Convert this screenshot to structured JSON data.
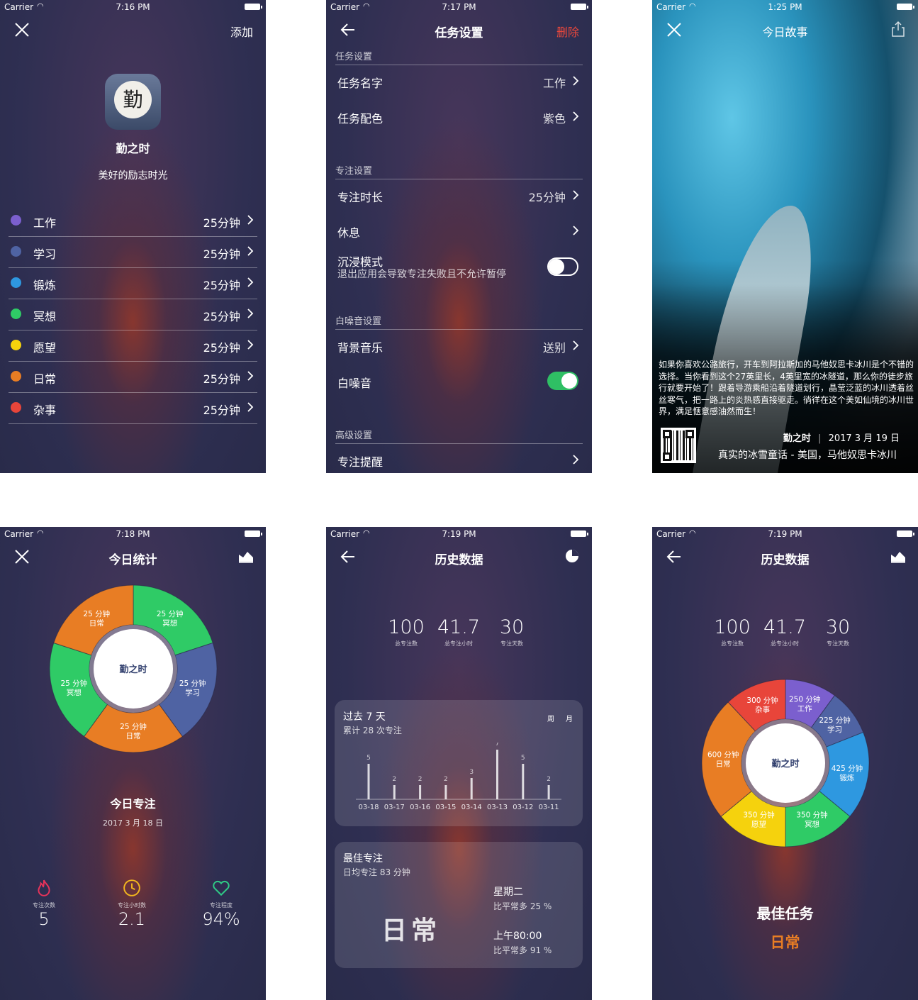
{
  "colors": {
    "accent_red": "#e9483c",
    "toggle_on": "#2fbf64",
    "work": "#7b5fce",
    "study": "#4f63a3",
    "exercise": "#2e98e0",
    "meditate": "#2fcb66",
    "wish": "#f5d20d",
    "daily": "#e87d24",
    "misc": "#e8453a"
  },
  "screen1": {
    "status": {
      "carrier": "Carrier",
      "time": "7:16 PM"
    },
    "nav_right": "添加",
    "app_name": "勤之时",
    "icon_char": "勤",
    "slogan": "美好的励志时光",
    "tasks": [
      {
        "name": "工作",
        "value": "25分钟",
        "color": "#7b5fce"
      },
      {
        "name": "学习",
        "value": "25分钟",
        "color": "#4f63a3"
      },
      {
        "name": "锻炼",
        "value": "25分钟",
        "color": "#2e98e0"
      },
      {
        "name": "冥想",
        "value": "25分钟",
        "color": "#2fcb66"
      },
      {
        "name": "愿望",
        "value": "25分钟",
        "color": "#f5d20d"
      },
      {
        "name": "日常",
        "value": "25分钟",
        "color": "#e87d24"
      },
      {
        "name": "杂事",
        "value": "25分钟",
        "color": "#e8453a"
      }
    ]
  },
  "screen2": {
    "status": {
      "carrier": "Carrier",
      "time": "7:17 PM"
    },
    "title": "任务设置",
    "nav_right": "删除",
    "sections": {
      "task": "任务设置",
      "focus": "专注设置",
      "noise": "白噪音设置",
      "advanced": "高级设置"
    },
    "rows": {
      "task_name": {
        "label": "任务名字",
        "value": "工作"
      },
      "task_color": {
        "label": "任务配色",
        "value": "紫色"
      },
      "focus_len": {
        "label": "专注时长",
        "value": "25分钟"
      },
      "rest": {
        "label": "休息",
        "value": ""
      },
      "immersive": {
        "label": "沉浸模式",
        "sub": "退出应用会导致专注失败且不允许暂停",
        "on": false
      },
      "bgm": {
        "label": "背景音乐",
        "value": "送别"
      },
      "white_noise": {
        "label": "白噪音",
        "on": true
      },
      "reminder": {
        "label": "专注提醒",
        "value": ""
      }
    }
  },
  "screen3": {
    "status": {
      "carrier": "Carrier",
      "time": "1:25 PM"
    },
    "title": "今日故事",
    "story": "如果你喜欢公路旅行，开车到阿拉斯加的马他奴思卡冰川是个不错的选择。当你看到这个27英里长，4英里宽的冰隧道，那么你的徒步旅行就要开始了！跟着导游乘船沿着隧道划行，晶莹泛蓝的冰川透着丝丝寒气，把一路上的炎热感直接驱走。徜徉在这个美如仙境的冰川世界，满足惬意感油然而生！",
    "brand": "勤之时",
    "date": "2017 3 月 19 日",
    "caption": "真实的冰雪童话 - 美国，马他奴思卡冰川"
  },
  "screen4": {
    "status": {
      "carrier": "Carrier",
      "time": "7:18 PM"
    },
    "title": "今日统计",
    "center": "勤之时",
    "segments": [
      {
        "label": "25 分钟",
        "name": "冥想",
        "minutes": 25,
        "color": "#2fcb66"
      },
      {
        "label": "25 分钟",
        "name": "学习",
        "minutes": 25,
        "color": "#4f63a3"
      },
      {
        "label": "25 分钟",
        "name": "日常",
        "minutes": 25,
        "color": "#e87d24"
      },
      {
        "label": "25 分钟",
        "name": "冥想",
        "minutes": 25,
        "color": "#2fcb66"
      },
      {
        "label": "25 分钟",
        "name": "日常",
        "minutes": 25,
        "color": "#e87d24"
      }
    ],
    "heading": "今日专注",
    "date": "2017 3 月 18 日",
    "stats": [
      {
        "label": "专注次数",
        "value": "5",
        "icon": "flame-icon",
        "color": "#e8335a"
      },
      {
        "label": "专注小时数",
        "value": "2.1",
        "icon": "clock-icon",
        "color": "#f2b61e"
      },
      {
        "label": "专注程度",
        "value": "94%",
        "icon": "heart-icon",
        "color": "#2fcb86"
      }
    ]
  },
  "screen5": {
    "status": {
      "carrier": "Carrier",
      "time": "7:19 PM"
    },
    "title": "历史数据",
    "summary": [
      {
        "value": "100",
        "label": "总专注数"
      },
      {
        "value": "41.7",
        "label": "总专注小时"
      },
      {
        "value": "30",
        "label": "专注天数"
      }
    ],
    "chart_card": {
      "title": "过去 7 天",
      "subtitle": "累计 28 次专注",
      "toggle_week": "周",
      "toggle_month": "月"
    },
    "best_card": {
      "title": "最佳专注",
      "subtitle": "日均专注 83 分钟",
      "task": "日常",
      "day": "星期二",
      "day_note": "比平常多 25 %",
      "time": "上午80:00",
      "time_note": "比平常多 91 %"
    }
  },
  "screen6": {
    "status": {
      "carrier": "Carrier",
      "time": "7:19 PM"
    },
    "title": "历史数据",
    "summary": [
      {
        "value": "100",
        "label": "总专注数"
      },
      {
        "value": "41.7",
        "label": "总专注小时"
      },
      {
        "value": "30",
        "label": "专注天数"
      }
    ],
    "center": "勤之时",
    "segments": [
      {
        "label": "250 分钟",
        "name": "工作",
        "minutes": 250,
        "color": "#7b5fce"
      },
      {
        "label": "225 分钟",
        "name": "学习",
        "minutes": 225,
        "color": "#4f63a3"
      },
      {
        "label": "425 分钟",
        "name": "锻炼",
        "minutes": 425,
        "color": "#2e98e0"
      },
      {
        "label": "350 分钟",
        "name": "冥想",
        "minutes": 350,
        "color": "#2fcb66"
      },
      {
        "label": "350 分钟",
        "name": "愿望",
        "minutes": 350,
        "color": "#f5d20d"
      },
      {
        "label": "600 分钟",
        "name": "日常",
        "minutes": 600,
        "color": "#e87d24"
      },
      {
        "label": "300 分钟",
        "name": "杂事",
        "minutes": 300,
        "color": "#e8453a"
      }
    ],
    "best_title": "最佳任务",
    "best_task": "日常"
  },
  "chart_data": {
    "type": "bar",
    "categories": [
      "03-18",
      "03-17",
      "03-16",
      "03-15",
      "03-14",
      "03-13",
      "03-12",
      "03-11"
    ],
    "values": [
      5,
      2,
      2,
      2,
      3,
      7,
      5,
      2
    ]
  }
}
